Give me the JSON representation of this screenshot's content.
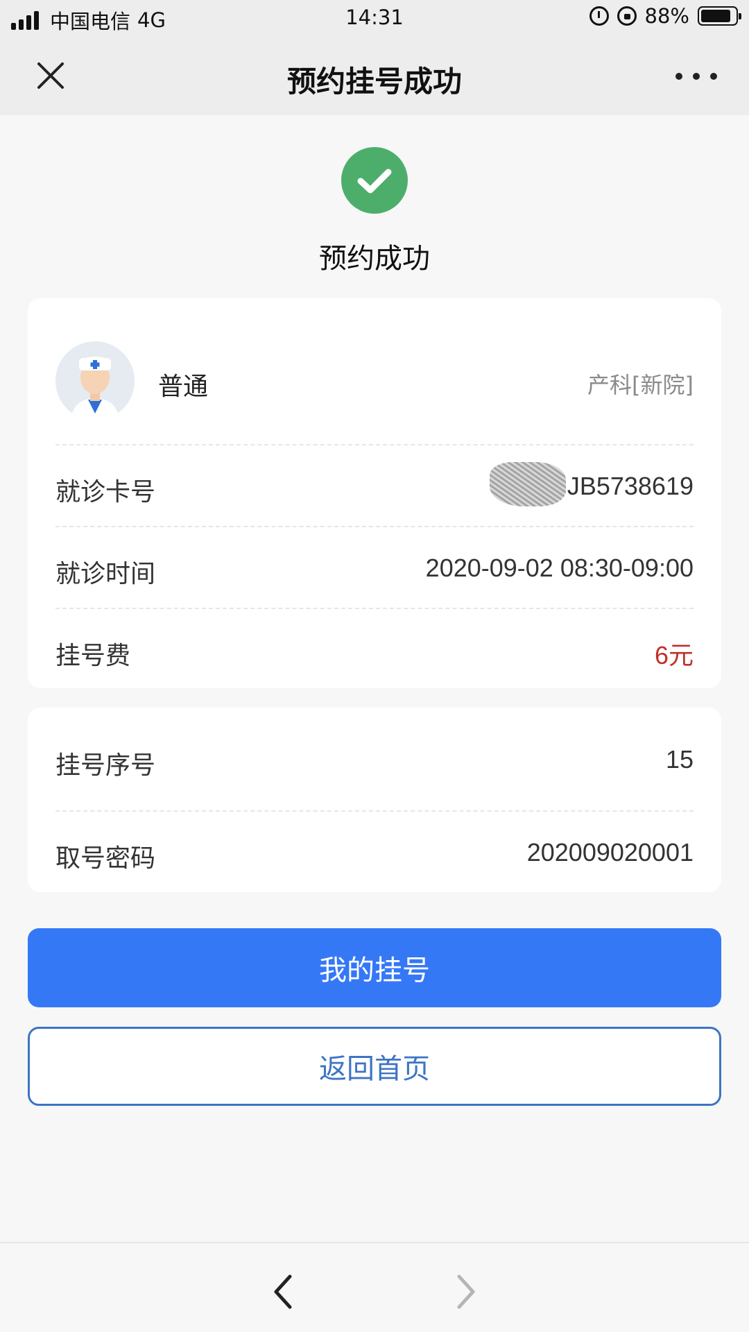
{
  "status_bar": {
    "carrier": "中国电信",
    "network": "4G",
    "time": "14:31",
    "battery": "88%",
    "battery_level": 0.88
  },
  "nav": {
    "title": "预约挂号成功"
  },
  "success": {
    "text": "预约成功",
    "color": "#4dae6c"
  },
  "appointment": {
    "doctor_type": "普通",
    "department": "产科[新院]",
    "rows": [
      {
        "label": "就诊卡号",
        "value": "JB5738619"
      },
      {
        "label": "就诊时间",
        "value": "2020-09-02 08:30-09:00"
      },
      {
        "label": "挂号费",
        "value": "6元"
      }
    ]
  },
  "queue": {
    "rows": [
      {
        "label": "挂号序号",
        "value": "15"
      },
      {
        "label": "取号密码",
        "value": "202009020001"
      }
    ]
  },
  "buttons": {
    "my_registration": "我的挂号",
    "back_home": "返回首页"
  },
  "colors": {
    "primary": "#3478f6",
    "outline": "#3d74c4",
    "fee": "#c0302a"
  }
}
